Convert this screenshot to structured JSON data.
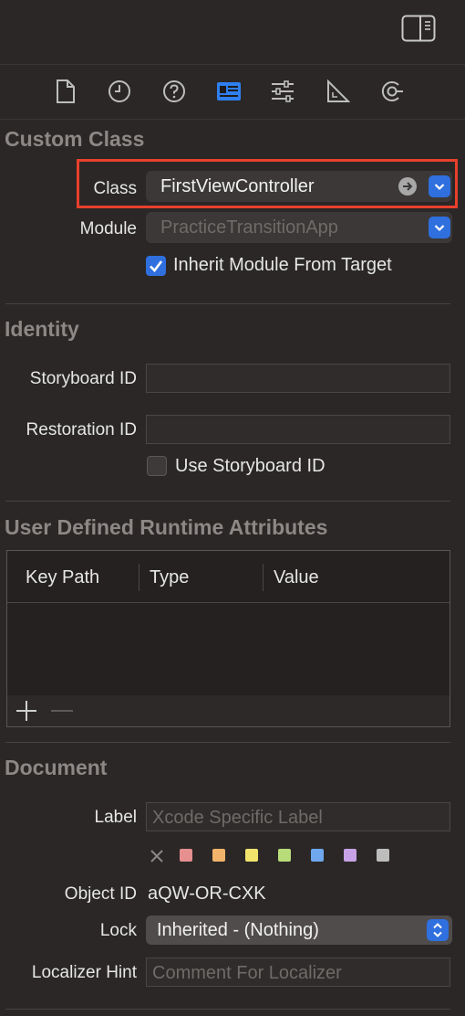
{
  "toolbar": {
    "top_icon": "inspector-toggle-icon",
    "tabs": [
      "file-icon",
      "history-icon",
      "help-icon",
      "identity-icon",
      "attributes-icon",
      "size-icon",
      "connections-icon"
    ]
  },
  "custom_class": {
    "title": "Custom Class",
    "class_label": "Class",
    "class_value": "FirstViewController",
    "module_label": "Module",
    "module_placeholder": "PracticeTransitionApp",
    "inherit_label": "Inherit Module From Target",
    "inherit_checked": true
  },
  "identity": {
    "title": "Identity",
    "storyboard_id_label": "Storyboard ID",
    "storyboard_id_value": "",
    "restoration_id_label": "Restoration ID",
    "restoration_id_value": "",
    "use_storyboard_label": "Use Storyboard ID",
    "use_storyboard_checked": false
  },
  "runtime_attributes": {
    "title": "User Defined Runtime Attributes",
    "columns": [
      "Key Path",
      "Type",
      "Value"
    ],
    "rows": []
  },
  "document": {
    "title": "Document",
    "label_label": "Label",
    "label_placeholder": "Xcode Specific Label",
    "object_id_label": "Object ID",
    "object_id_value": "aQW-OR-CXK",
    "lock_label": "Lock",
    "lock_value": "Inherited - (Nothing)",
    "localizer_label": "Localizer Hint",
    "localizer_placeholder": "Comment For Localizer",
    "swatch_colors": [
      "#e58f8f",
      "#f2b36a",
      "#f1e46d",
      "#b8dc79",
      "#6fa8ee",
      "#c8a2e6",
      "#bdbdbd"
    ]
  },
  "colors": {
    "accent": "#2f6fde",
    "highlight": "#e8402c",
    "background": "#2a2726"
  }
}
